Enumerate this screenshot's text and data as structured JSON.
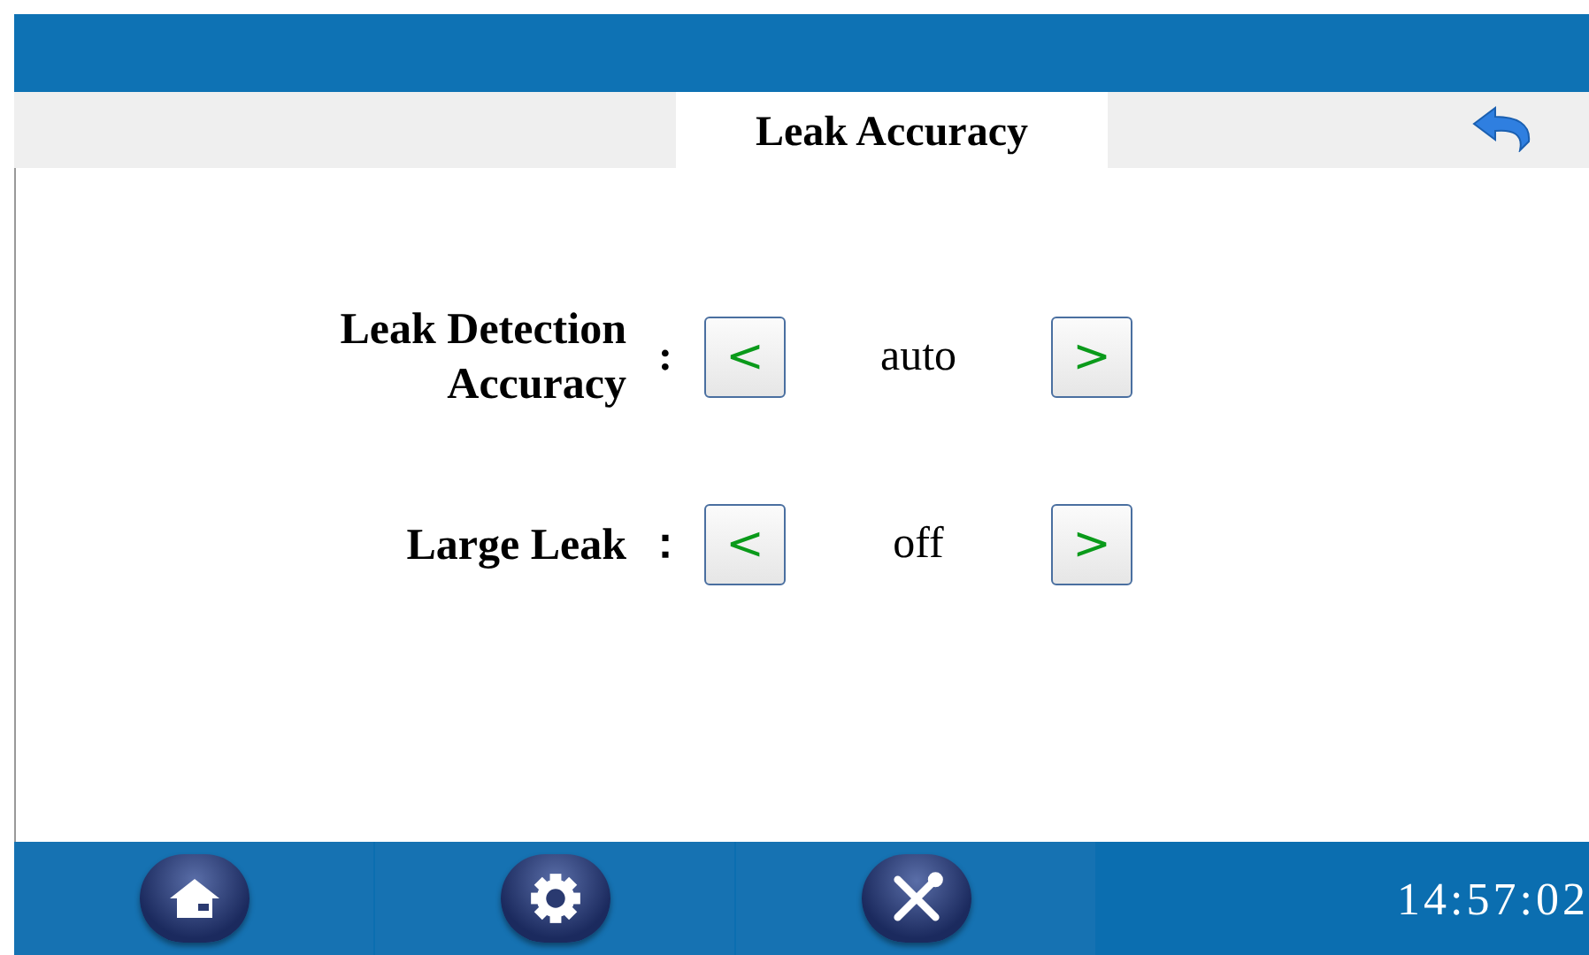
{
  "tab": {
    "title": "Leak Accuracy"
  },
  "settings": [
    {
      "label": "Leak Detection\nAccuracy",
      "separator": ":",
      "prev": "<",
      "value": "auto",
      "next": ">"
    },
    {
      "label": "Large  Leak",
      "separator": "：",
      "prev": "<",
      "value": "off",
      "next": ">"
    }
  ],
  "status_bar": {
    "time": "14:57:02"
  }
}
